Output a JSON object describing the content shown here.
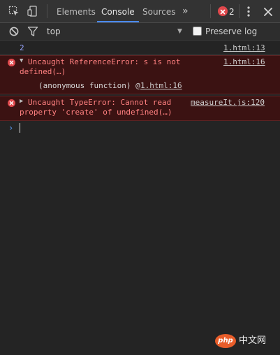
{
  "tabs": [
    {
      "label": "Elements",
      "active": false
    },
    {
      "label": "Console",
      "active": true
    },
    {
      "label": "Sources",
      "active": false
    }
  ],
  "more_tabs_glyph": "»",
  "error_badge": {
    "count": "2",
    "color": "#e0484c"
  },
  "icons": {
    "inspect": "inspect-element-icon",
    "device": "device-toolbar-icon",
    "clear": "clear-console-icon",
    "filter": "filter-icon",
    "menu": "kebab-menu-icon",
    "close": "close-icon"
  },
  "filter_bar": {
    "context": "top",
    "context_arrow": "▼",
    "preserve_log_label": "Preserve log",
    "preserve_log_checked": false
  },
  "messages": [
    {
      "type": "log",
      "text": "2",
      "source": "1.html:13"
    },
    {
      "type": "error",
      "expanded": true,
      "line1": "Uncaught ReferenceError: s is not",
      "line2": "defined(…)",
      "source": "1.html:16",
      "stack": {
        "frame": "(anonymous function) @ ",
        "link": "1.html:16"
      }
    },
    {
      "type": "error",
      "expanded": false,
      "line1": "Uncaught TypeError: Cannot read",
      "line2": "property 'create' of undefined(…)",
      "source": "measureIt.js:120"
    }
  ],
  "prompt": {
    "glyph": "›",
    "value": ""
  },
  "watermark": {
    "badge": "php",
    "text": "中文网"
  },
  "colors": {
    "background": "#242424",
    "toolbar": "#333333",
    "error_row": "#3b1212",
    "error_text": "#ff8080",
    "accent_tab": "#4a8af4",
    "log_number": "#9aa7ff"
  }
}
